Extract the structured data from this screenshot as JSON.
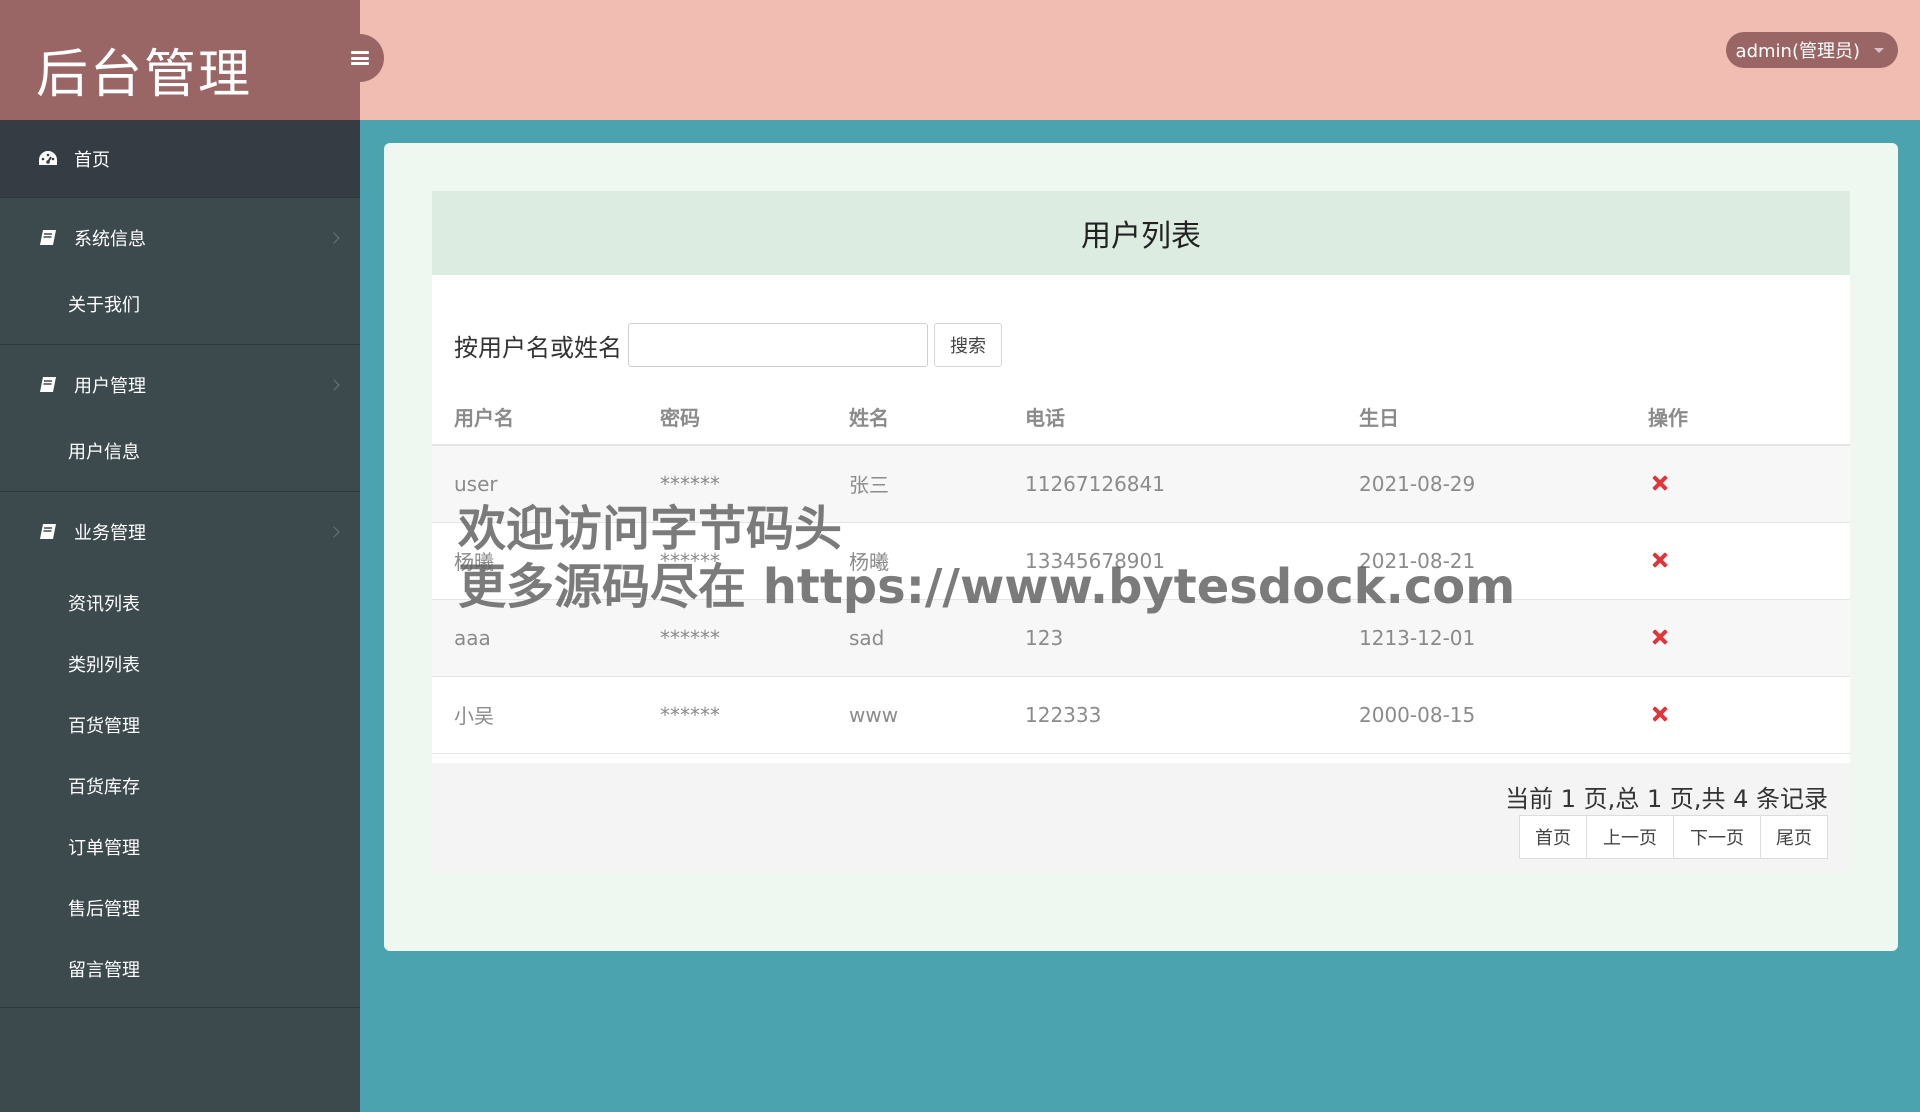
{
  "sidebar": {
    "brand": "后台管理",
    "home": "首页",
    "groups": [
      {
        "label": "系统信息",
        "items": [
          "关于我们"
        ]
      },
      {
        "label": "用户管理",
        "items": [
          "用户信息"
        ]
      },
      {
        "label": "业务管理",
        "items": [
          "资讯列表",
          "类别列表",
          "百货管理",
          "百货库存",
          "订单管理",
          "售后管理",
          "留言管理"
        ]
      }
    ]
  },
  "header": {
    "user": "admin(管理员)"
  },
  "list": {
    "title": "用户列表",
    "search_label": "按用户名或姓名",
    "search_value": "",
    "search_button": "搜索",
    "columns": [
      "用户名",
      "密码",
      "姓名",
      "电话",
      "生日",
      "操作"
    ],
    "rows": [
      {
        "username": "user",
        "password": "******",
        "name": "张三",
        "phone": "11267126841",
        "birthday": "2021-08-29"
      },
      {
        "username": "杨曦",
        "password": "******",
        "name": "杨曦",
        "phone": "13345678901",
        "birthday": "2021-08-21"
      },
      {
        "username": "aaa",
        "password": "******",
        "name": "sad",
        "phone": "123",
        "birthday": "1213-12-01"
      },
      {
        "username": "小吴",
        "password": "******",
        "name": "www",
        "phone": "122333",
        "birthday": "2000-08-15"
      }
    ],
    "record_info": "当前 1 页,总 1 页,共 4 条记录",
    "pager": {
      "first": "首页",
      "prev": "上一页",
      "next": "下一页",
      "last": "尾页"
    }
  },
  "watermark": {
    "line1": "欢迎访问字节码头",
    "line2": "更多源码尽在  https://www.bytesdock.com"
  },
  "colors": {
    "brand_bg": "#9a6665",
    "header_bg": "#f1bcb1",
    "sidebar_bg": "#3d4a4d",
    "page_bg": "#4ba3b0",
    "delete": "#e0353a"
  }
}
